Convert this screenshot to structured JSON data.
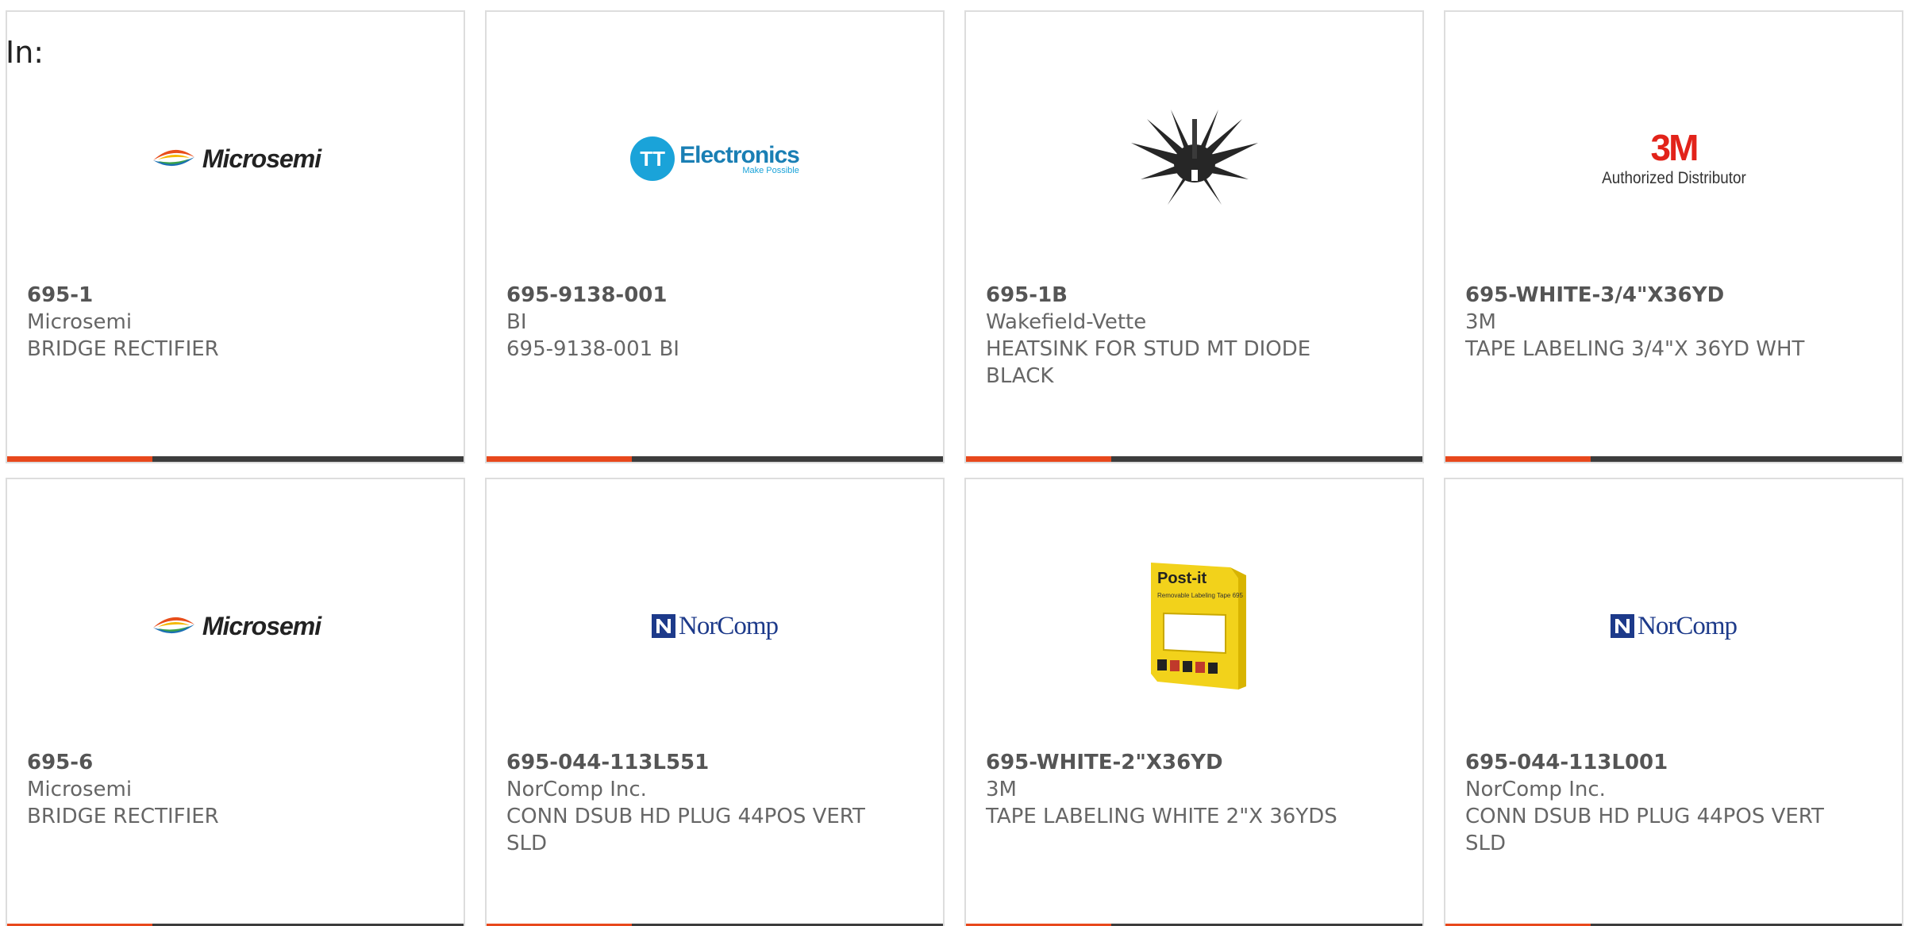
{
  "search": {
    "in_label": "In:"
  },
  "products": [
    {
      "part_number": "695-1",
      "manufacturer": "Microsemi",
      "description": "BRIDGE RECTIFIER",
      "image": "microsemi-logo",
      "logo_text": "Microsemi"
    },
    {
      "part_number": "695-9138-001",
      "manufacturer": "BI",
      "description": "695-9138-001 BI",
      "image": "tt-electronics-logo",
      "logo_text": "Electronics",
      "logo_initials": "TT",
      "logo_tagline": "Make Possible"
    },
    {
      "part_number": "695-1B",
      "manufacturer": "Wakefield-Vette",
      "description": "HEATSINK FOR STUD MT DIODE BLACK",
      "image": "heatsink-photo"
    },
    {
      "part_number": "695-WHITE-3/4\"X36YD",
      "manufacturer": "3M",
      "description": "TAPE LABELING 3/4\"X 36YD WHT",
      "image": "3m-logo",
      "logo_text": "3M",
      "logo_subtext": "Authorized Distributor"
    },
    {
      "part_number": "695-6",
      "manufacturer": "Microsemi",
      "description": "BRIDGE RECTIFIER",
      "image": "microsemi-logo",
      "logo_text": "Microsemi"
    },
    {
      "part_number": "695-044-113L551",
      "manufacturer": "NorComp Inc.",
      "description": "CONN DSUB HD PLUG 44POS VERT SLD",
      "image": "norcomp-logo",
      "logo_text": "NorComp"
    },
    {
      "part_number": "695-WHITE-2\"X36YD",
      "manufacturer": "3M",
      "description": "TAPE LABELING WHITE 2\"X 36YDS",
      "image": "post-it-tape-photo",
      "logo_text": "Post-it",
      "logo_subtext": "Removable Labeling Tape 695"
    },
    {
      "part_number": "695-044-113L001",
      "manufacturer": "NorComp Inc.",
      "description": "CONN DSUB HD PLUG 44POS VERT SLD",
      "image": "norcomp-logo",
      "logo_text": "NorComp"
    }
  ],
  "colors": {
    "accent": "#e8481c",
    "bar": "#3c3c3c",
    "text": "#666666",
    "border": "#dddddd",
    "microsemi_swoosh": "#e84e1b",
    "tt_blue": "#1aa3d9",
    "3m_red": "#e2231a",
    "norcomp_blue": "#1d3a8a"
  }
}
